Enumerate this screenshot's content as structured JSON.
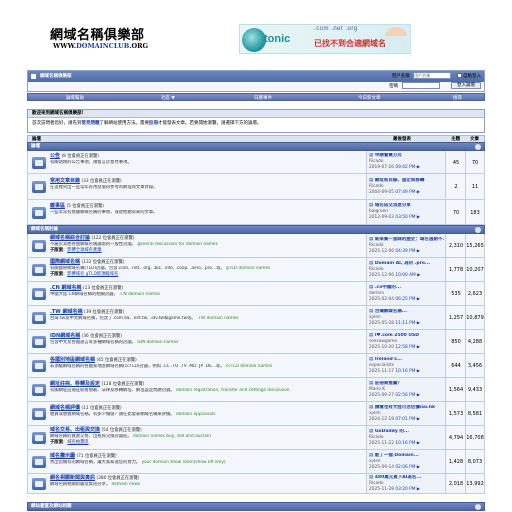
{
  "header": {
    "logo_title": "網域名稱俱樂部",
    "logo_url_prefix": "WWW.",
    "logo_url_main": "DOMAINCLUB",
    "logo_url_suffix": ".ORG",
    "banner": {
      "brand": "tonic",
      "tlds": ".com .net .org",
      "slogan": "已找不到合適網域名？"
    }
  },
  "topbar": {
    "title": "網域名稱俱樂部",
    "username_placeholder": "用戶名稱",
    "username_label": "用戶名稱",
    "remember_label": "自動登入",
    "password_label": "密碼",
    "login_button": "登入論壇"
  },
  "nav": {
    "items": [
      "論壇幫助",
      "社區 ▼",
      "日曆事件",
      "今日新文章",
      "搜尋"
    ]
  },
  "welcome": {
    "title": "歡迎來到網域名稱俱樂部!",
    "text_a": "首次訪問者您好，請先到",
    "link_faq": "常見問題",
    "text_b": "了解網站使用方法。需要",
    "link_register": "註冊",
    "text_c": "才能發表文章。若要開始瀏覽，請選擇下方的論壇。"
  },
  "columns": {
    "forum": "論壇",
    "last_post": "最後發表",
    "threads": "主題",
    "posts": "文章"
  },
  "categories": [
    {
      "title": "論壇",
      "forums": [
        {
          "name": "公告",
          "sub": "(8 位會員正在瀏覽)",
          "desc": "有關站務的公告事項，請留言於意見事項。",
          "desc_en": "",
          "mods_label": "",
          "mods": "",
          "last_title": "申請會員方式",
          "last_user": "Ricado",
          "last_date": "2019-07-26",
          "last_time": "09:42 PM",
          "threads": "45",
          "posts": "70"
        },
        {
          "name": "常用文章目錄",
          "sub": "(33 位會員正在瀏覽)",
          "desc": "在這裡列出一些常年有用及值得參考的網址與文章目錄。",
          "desc_en": "",
          "mods_label": "",
          "mods": "",
          "last_title": "網址和目錄、固定和移轉",
          "last_user": "Ricado",
          "last_date": "2004-09-05",
          "last_time": "07:49 PM",
          "threads": "2",
          "posts": "11"
        },
        {
          "name": "雜事區",
          "sub": "(5 位會員正在瀏覽)",
          "desc": "一些常常有無關網域名稱的事務，或從他處得來的文章。",
          "desc_en": "",
          "mods_label": "",
          "mods": "",
          "last_title": "域名成交消息分享",
          "last_user": "baigreen",
          "last_date": "2012-09-03",
          "last_time": "03:50 PM",
          "threads": "70",
          "posts": "183"
        }
      ]
    },
    {
      "title": "網域名稱討論",
      "forums": [
        {
          "name": "網域名稱綜合討論",
          "sub": "(122 位會員正在瀏覽)",
          "desc": "不屬於其他各個網域名稱論壇的一般性討論。",
          "desc_en": "general discussion for domain names",
          "mods_label": "子版面",
          "mods": "影響全球域名產業",
          "last_title": "新來賓一直踩的歷史：域名過期不...",
          "last_user": "Ricado",
          "last_date": "2025-12-06",
          "last_time": "04:39 PM",
          "threads": "2,310",
          "posts": "15,265"
        },
        {
          "name": "國際網域名稱",
          "sub": "(132 位會員正在瀏覽)",
          "desc": "有關國際網域名稱(TLD)討論，包含.com, .net, .org, .biz, .info, .coop, .aero, .pro...等。",
          "desc_en": "gTLD domain names",
          "mods_label": "子版面",
          "mods": "影響域名 gTLD新頂級域名",
          "last_title": "Domain AI, 為何 .pro...",
          "last_user": "Ricado",
          "last_date": "2025-12-06",
          "last_time": "10:00 AM",
          "threads": "1,778",
          "posts": "10,207"
        },
        {
          "name": ".CN 網域名稱",
          "sub": "(13 位會員正在瀏覽)",
          "desc": "中國大陸.CN網域名稱的相關討論。",
          "desc_en": ".CN domain names",
          "mods_label": "",
          "mods": "",
          "last_title": ".cn中國的...",
          "last_user": "dermin",
          "last_date": "2025-02-04",
          "last_time": "06:25 PM",
          "threads": "535",
          "posts": "2,623"
        },
        {
          "name": ".TW 網域名稱",
          "sub": "(39 位會員正在瀏覽)",
          "desc": "台灣.tw及中文網域名稱，包含了.com.tw, .net.tw, .idv.tw和game.tw等。",
          "desc_en": ".TW domain names",
          "mods_label": "",
          "mods": "",
          "last_title": "台灣網域名稱...",
          "last_user": "xylen",
          "last_date": "2025-05-28",
          "last_time": "11:11 PM",
          "threads": "1,257",
          "posts": "10,879"
        },
        {
          "name": "IDN網域名稱",
          "sub": "(36 位會員正在瀏覽)",
          "desc": "包含中文及各國語言等多種網域名稱的討論。",
          "desc_en": "IDN domain names",
          "mods_label": "",
          "mods": "",
          "last_title": "I♥.com 2500 USD",
          "last_user": "seesawgame",
          "last_date": "2025-10-20",
          "last_time": "12:58 PM",
          "threads": "850",
          "posts": "4,288"
        },
        {
          "name": "各國別地區網域名稱",
          "sub": "(45 位會員正在瀏覽)",
          "desc": "非頂級網域名稱的各國家地區網域名稱(ccTLD)討論，例如 .CC .TO .TV .MD .JP .DE...等。",
          "desc_en": "ccTLD domain names",
          "mods_label": "",
          "mods": "",
          "last_title": "Ireland's...",
          "last_user": "especialists",
          "last_date": "2025-11-17",
          "last_time": "10:16 PM",
          "threads": "644",
          "posts": "3,456"
        },
        {
          "name": "網址註冊、移轉及設定",
          "sub": "(128 位會員正在瀏覽)",
          "desc": "有關網址註冊註冊者規範、法律及移轉網址、網址設定問題討論。",
          "desc_en": "domain registration, transfer and settings discussion",
          "mods_label": "",
          "mods": "",
          "last_title": "註冊商推薦？",
          "last_user": "Mario K",
          "last_date": "2025-09-27",
          "last_time": "02:56 PM",
          "threads": "1,564",
          "posts": "9,433"
        },
        {
          "name": "網域名稱評價",
          "sub": "(11 位會員正在瀏覽)",
          "desc": "想買或想賣網域名稱，有多少價值？請在此發表網域名稱來評價。",
          "desc_en": "domain appraisals",
          "mods_label": "",
          "mods": "",
          "last_title": "請看也有大陸可否估價iso.hk",
          "last_user": "xylen",
          "last_date": "2024-12-18",
          "last_time": "07:01 PM",
          "threads": "1,573",
          "posts": "8,581"
        },
        {
          "name": "域名交易、出租與交換",
          "sub": "(54 位會員正在瀏覽)",
          "desc": "網域名稱的買賣交易、出租與交換討論區。",
          "desc_en": "domain names buy, sell and auction",
          "mods_label": "子版面",
          "mods": "域名拍賣區",
          "last_title": "GoDaddy 的...",
          "last_user": "Ricado",
          "last_date": "2025-11-22",
          "last_time": "10:16 PM",
          "threads": "4,794",
          "posts": "16,708"
        },
        {
          "name": "域名攤示廳",
          "sub": "(71 位會員正在瀏覽)",
          "desc": "秀出您擁有的網域名稱，讓大家知道您的實力。",
          "desc_en": "your domain show room(show off only)",
          "mods_label": "",
          "mods": "",
          "last_title": "能了一個 Domain...",
          "last_user": "xylen",
          "last_date": "2025-09-14",
          "last_time": "02:06 PM",
          "threads": "1,428",
          "posts": "8,073"
        },
        {
          "name": "網名相關新聞與資訊",
          "sub": "(380 位會員正在瀏覽)",
          "desc": "網域名稱相關新聞及資訊分享。",
          "desc_en": "domain news",
          "mods_label": "",
          "mods": "",
          "last_title": "480萬元買下AI為名...",
          "last_user": "Ricado",
          "last_date": "2025-11-28",
          "last_time": "03:20 PM",
          "threads": "2,018",
          "posts": "13,992"
        }
      ]
    },
    {
      "title": "網站建置及網站相關",
      "forums": []
    }
  ]
}
